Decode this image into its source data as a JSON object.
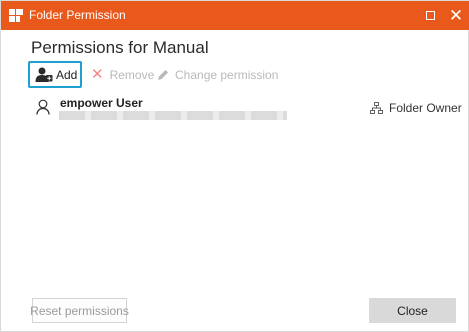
{
  "window": {
    "title": "Folder Permission",
    "accent_color": "#e9591c",
    "controls": {
      "maximize_icon": "maximize-icon",
      "close_icon": "close-icon"
    }
  },
  "dialog": {
    "heading": "Permissions for Manual"
  },
  "toolbar": {
    "add_label": "Add",
    "add_icon": "add-user-icon",
    "remove_label": "Remove",
    "remove_icon": "x-icon",
    "change_label": "Change permission",
    "change_icon": "pencil-icon",
    "focus_color": "#1ea0d0"
  },
  "permissions": [
    {
      "user_name": "empower User",
      "user_icon": "person-icon",
      "role": "Folder Owner",
      "role_icon": "hierarchy-icon"
    }
  ],
  "footer": {
    "reset_label": "Reset permissions",
    "close_label": "Close"
  }
}
